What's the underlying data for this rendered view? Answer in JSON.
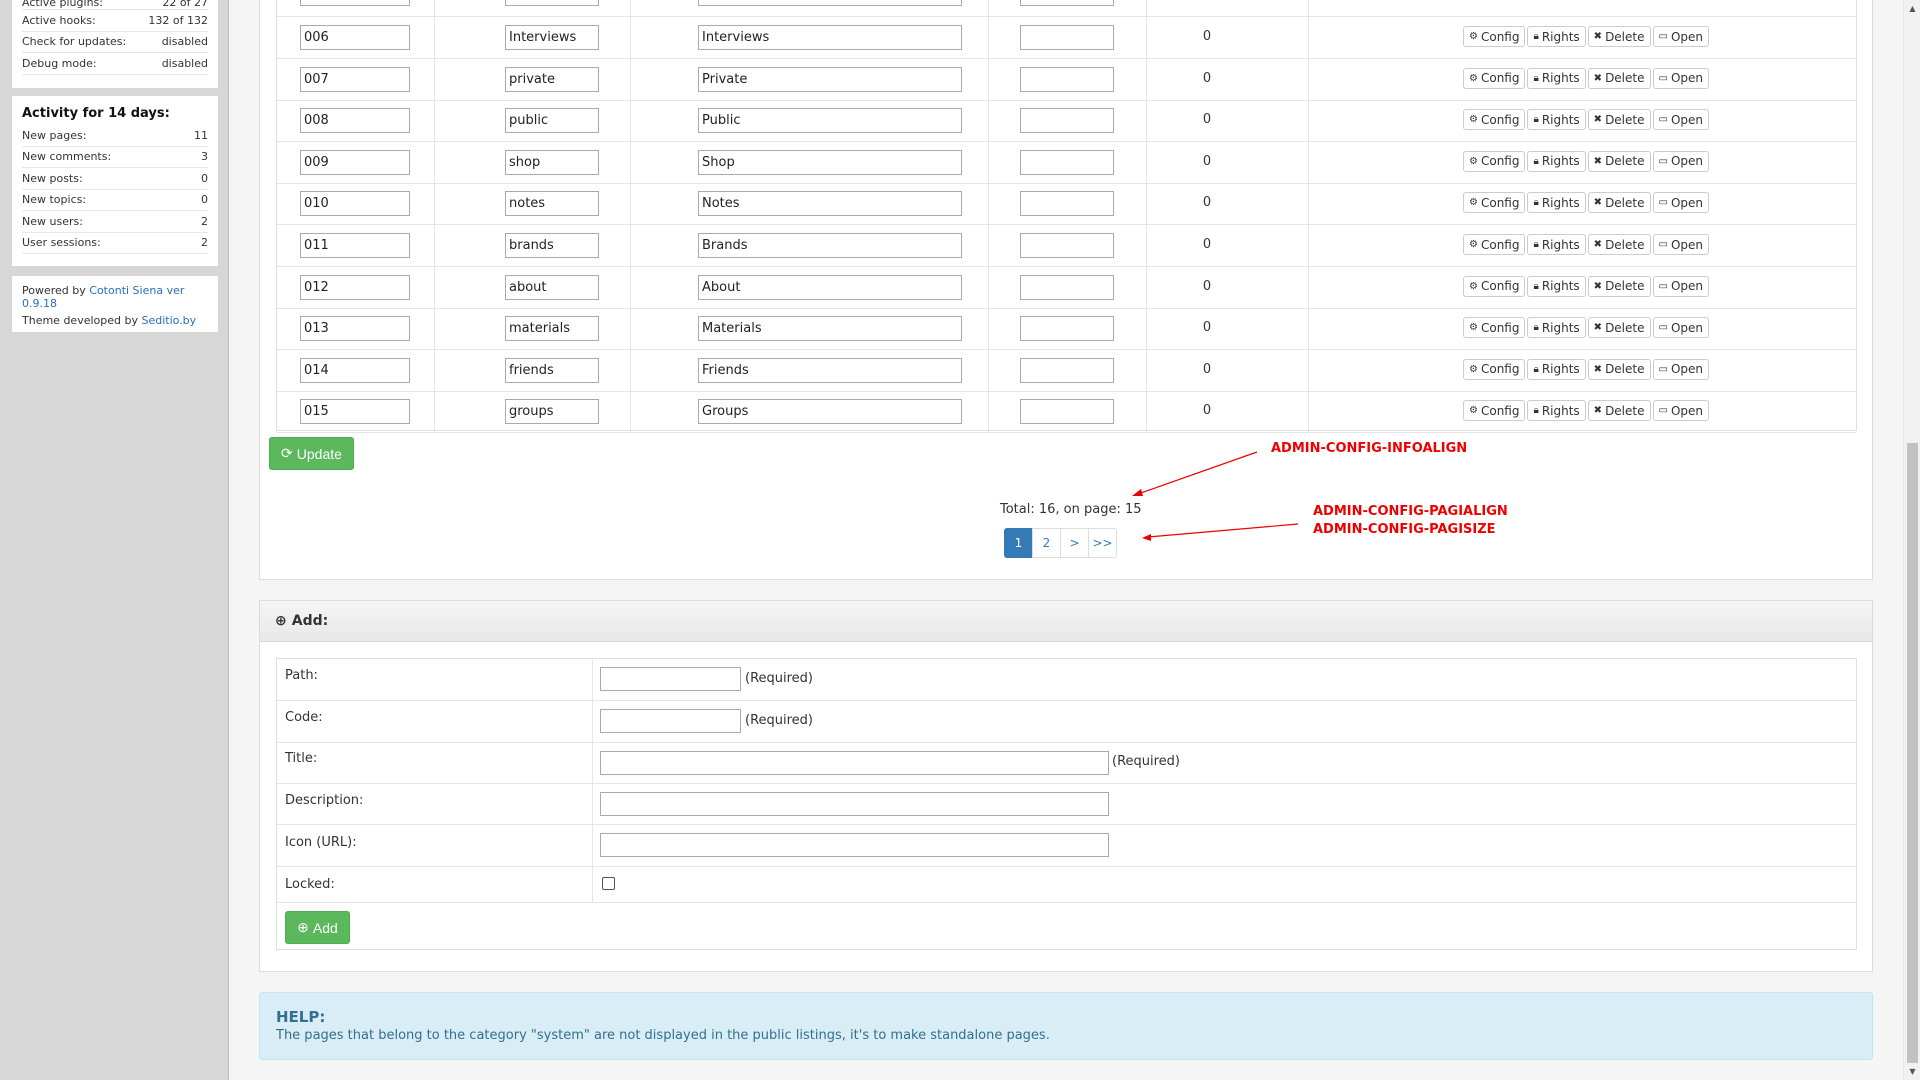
{
  "sidebar": {
    "stats": [
      {
        "label": "Active plugins:",
        "value": "22 of 27"
      },
      {
        "label": "Active hooks:",
        "value": "132 of 132"
      },
      {
        "label": "Check for updates:",
        "value": "disabled"
      },
      {
        "label": "Debug mode:",
        "value": "disabled"
      }
    ],
    "activity_title": "Activity for 14 days:",
    "activity": [
      {
        "label": "New pages:",
        "value": "11"
      },
      {
        "label": "New comments:",
        "value": "3"
      },
      {
        "label": "New posts:",
        "value": "0"
      },
      {
        "label": "New topics:",
        "value": "0"
      },
      {
        "label": "New users:",
        "value": "2"
      },
      {
        "label": "User sessions:",
        "value": "2"
      }
    ],
    "powered_prefix": "Powered by",
    "powered_link": "Cotonti Siena ver 0.9.18",
    "theme_prefix": "Theme developed by",
    "theme_link": "Seditio.by"
  },
  "table": {
    "rows": [
      {
        "path": "006",
        "code": "Interviews",
        "title": "Interviews",
        "count": "0"
      },
      {
        "path": "007",
        "code": "private",
        "title": "Private",
        "count": "0"
      },
      {
        "path": "008",
        "code": "public",
        "title": "Public",
        "count": "0"
      },
      {
        "path": "009",
        "code": "shop",
        "title": "Shop",
        "count": "0"
      },
      {
        "path": "010",
        "code": "notes",
        "title": "Notes",
        "count": "0"
      },
      {
        "path": "011",
        "code": "brands",
        "title": "Brands",
        "count": "0"
      },
      {
        "path": "012",
        "code": "about",
        "title": "About",
        "count": "0"
      },
      {
        "path": "013",
        "code": "materials",
        "title": "Materials",
        "count": "0"
      },
      {
        "path": "014",
        "code": "friends",
        "title": "Friends",
        "count": "0"
      },
      {
        "path": "015",
        "code": "groups",
        "title": "Groups",
        "count": "0"
      }
    ],
    "buttons": {
      "config": "Config",
      "rights": "Rights",
      "delete": "Delete",
      "open": "Open"
    },
    "update_label": "Update",
    "total_text": "Total: 16, on page: 15",
    "pages": [
      "1",
      "2",
      ">",
      ">>"
    ]
  },
  "annotations": {
    "infoalign": "ADMIN-CONFIG-INFOALIGN",
    "pagialign": "ADMIN-CONFIG-PAGIALIGN",
    "pagisize": "ADMIN-CONFIG-PAGISIZE"
  },
  "add": {
    "heading": "Add:",
    "path_label": "Path:",
    "code_label": "Code:",
    "title_label": "Title:",
    "description_label": "Description:",
    "icon_label": "Icon (URL):",
    "locked_label": "Locked:",
    "required": "(Required)",
    "button_label": "Add"
  },
  "help": {
    "title": "HELP:",
    "text": "The pages that belong to the category \"system\" are not displayed in the public listings, it's to make standalone pages."
  },
  "colors": {
    "accent": "#337ab7",
    "success": "#5cb85c",
    "annotation": "#e00000",
    "help_bg": "#d9edf7"
  }
}
